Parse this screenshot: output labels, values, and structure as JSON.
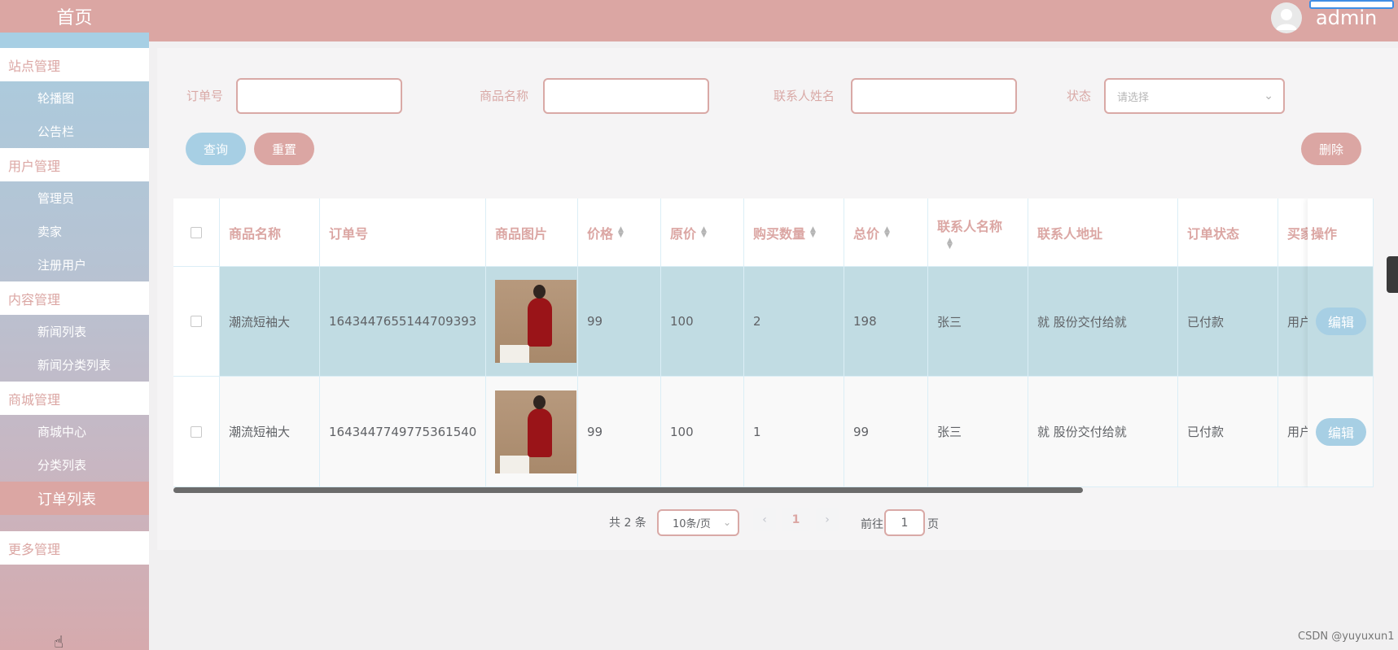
{
  "sidebar": {
    "home": "首页",
    "groups": [
      {
        "title": "站点管理",
        "items": [
          "轮播图",
          "公告栏"
        ]
      },
      {
        "title": "用户管理",
        "items": [
          "管理员",
          "卖家",
          "注册用户"
        ]
      },
      {
        "title": "内容管理",
        "items": [
          "新闻列表",
          "新闻分类列表"
        ]
      },
      {
        "title": "商城管理",
        "items": [
          "商城中心",
          "分类列表",
          "订单列表"
        ]
      },
      {
        "title": "更多管理",
        "items": []
      }
    ],
    "active_item": "订单列表"
  },
  "header": {
    "username": "admin"
  },
  "filters": {
    "order_no_label": "订单号",
    "product_name_label": "商品名称",
    "contact_name_label": "联系人姓名",
    "status_label": "状态",
    "status_placeholder": "请选择",
    "order_no_value": "",
    "product_name_value": "",
    "contact_name_value": ""
  },
  "buttons": {
    "query": "查询",
    "reset": "重置",
    "delete": "删除",
    "edit": "编辑"
  },
  "table": {
    "headers": [
      "商品名称",
      "订单号",
      "商品图片",
      "价格",
      "原价",
      "购买数量",
      "总价",
      "联系人名称",
      "联系人地址",
      "订单状态",
      "买家",
      "操作"
    ],
    "rows": [
      {
        "product_name": "潮流短袖大",
        "order_no": "1643447655144709393",
        "price": "99",
        "original_price": "100",
        "quantity": "2",
        "total": "198",
        "contact_name": "张三",
        "contact_address": "就 股份交付给就",
        "status": "已付款",
        "buyer": "用户"
      },
      {
        "product_name": "潮流短袖大",
        "order_no": "1643447749775361540",
        "price": "99",
        "original_price": "100",
        "quantity": "1",
        "total": "99",
        "contact_name": "张三",
        "contact_address": "就 股份交付给就",
        "status": "已付款",
        "buyer": "用户"
      }
    ]
  },
  "pagination": {
    "total_text": "共 2 条",
    "page_size": "10条/页",
    "current_page": "1",
    "goto_label": "前往",
    "goto_value": "1",
    "page_suffix": "页"
  },
  "watermark": "CSDN @yuyuxun1",
  "colors": {
    "accent_pink": "#dba6a3",
    "accent_blue": "#a7cfe4",
    "row_highlight": "#c1dce3"
  }
}
